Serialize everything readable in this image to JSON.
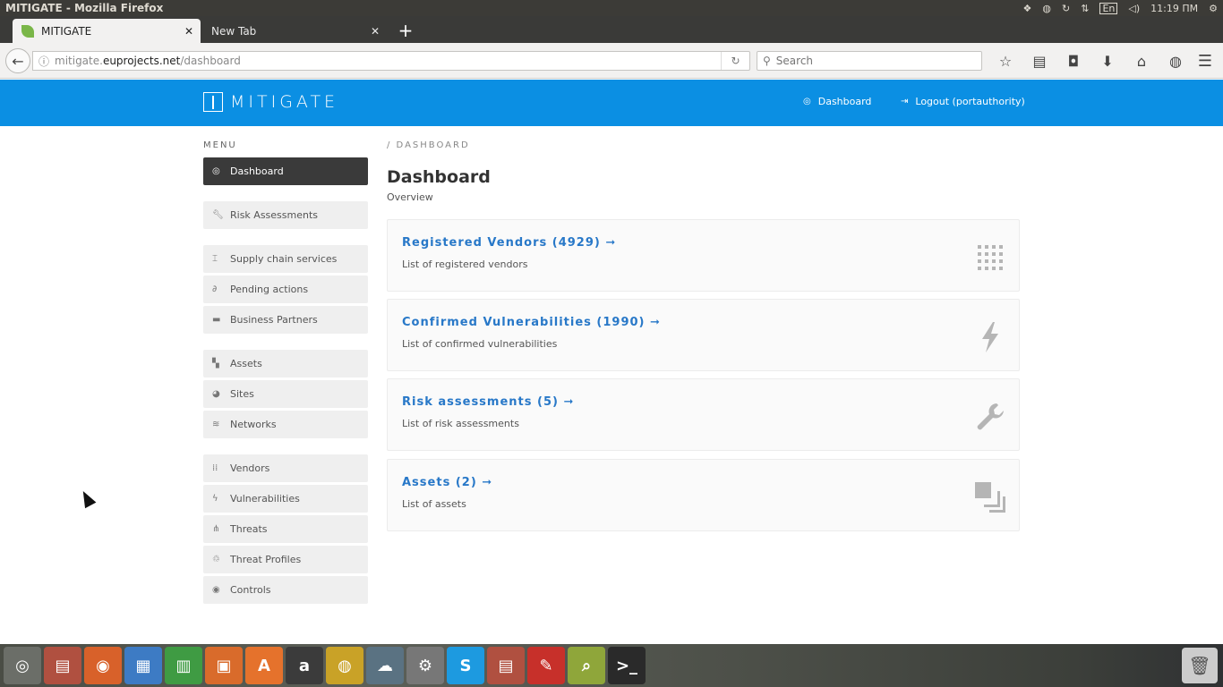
{
  "os": {
    "window_title": "MITIGATE - Mozilla Firefox",
    "clock": "11:19 ПМ",
    "keyboard_layout": "En"
  },
  "browser": {
    "tabs": [
      {
        "label": "MITIGATE",
        "active": true
      },
      {
        "label": "New Tab",
        "active": false
      }
    ],
    "url_prefix": "mitigate.",
    "url_domain": "euprojects.net",
    "url_path": "/dashboard",
    "search_placeholder": "Search"
  },
  "app": {
    "brand": "MITIGATE",
    "header_links": [
      {
        "label": "Dashboard",
        "icon": "dashboard-icon"
      },
      {
        "label": "Logout (portauthority)",
        "icon": "logout-icon"
      }
    ],
    "menu_label": "MENU",
    "sidebar": [
      {
        "label": "Dashboard",
        "icon": "dashboard-icon",
        "active": true
      },
      {
        "label": "Risk Assessments",
        "icon": "wrench-icon"
      },
      {
        "label": "Supply chain services",
        "icon": "supply-chain-icon"
      },
      {
        "label": "Pending actions",
        "icon": "paperclip-icon"
      },
      {
        "label": "Business Partners",
        "icon": "briefcase-icon"
      },
      {
        "label": "Assets",
        "icon": "assets-icon"
      },
      {
        "label": "Sites",
        "icon": "globe-icon"
      },
      {
        "label": "Networks",
        "icon": "wifi-icon"
      },
      {
        "label": "Vendors",
        "icon": "grid-icon"
      },
      {
        "label": "Vulnerabilities",
        "icon": "bolt-icon"
      },
      {
        "label": "Threats",
        "icon": "bug-icon"
      },
      {
        "label": "Threat Profiles",
        "icon": "recycle-icon"
      },
      {
        "label": "Controls",
        "icon": "eye-icon"
      }
    ],
    "breadcrumb": "/ DASHBOARD",
    "page_title": "Dashboard",
    "page_subtitle": "Overview",
    "cards": [
      {
        "title": "Registered Vendors (4929) ➞",
        "desc": "List of registered vendors",
        "icon": "grid-icon"
      },
      {
        "title": "Confirmed Vulnerabilities (1990) ➞",
        "desc": "List of confirmed vulnerabilities",
        "icon": "bolt-icon"
      },
      {
        "title": "Risk assessments (5) ➞",
        "desc": "List of risk assessments",
        "icon": "wrench-icon"
      },
      {
        "title": "Assets (2) ➞",
        "desc": "List of assets",
        "icon": "assets-icon"
      }
    ]
  },
  "taskbar": {
    "apps": [
      {
        "name": "ubuntu-dash-icon",
        "color": "#6b6e68",
        "glyph": "◎"
      },
      {
        "name": "files-icon",
        "color": "#b05040",
        "glyph": "▤"
      },
      {
        "name": "firefox-icon",
        "color": "#d8612a",
        "glyph": "◉"
      },
      {
        "name": "writer-icon",
        "color": "#3d7bc4",
        "glyph": "▦"
      },
      {
        "name": "calc-icon",
        "color": "#3f9b43",
        "glyph": "▥"
      },
      {
        "name": "impress-icon",
        "color": "#d96b2b",
        "glyph": "▣"
      },
      {
        "name": "software-center-icon",
        "color": "#e5722c",
        "glyph": "A"
      },
      {
        "name": "amazon-icon",
        "color": "#3b3b3b",
        "glyph": "a"
      },
      {
        "name": "chrome-icon",
        "color": "#c9a227",
        "glyph": "◍"
      },
      {
        "name": "cloud-icon",
        "color": "#5a7282",
        "glyph": "☁"
      },
      {
        "name": "settings-icon",
        "color": "#777",
        "glyph": "⚙"
      },
      {
        "name": "skype-icon",
        "color": "#1d9ae0",
        "glyph": "S"
      },
      {
        "name": "archive-icon",
        "color": "#b05040",
        "glyph": "▤"
      },
      {
        "name": "pdf-icon",
        "color": "#c7302a",
        "glyph": "✎"
      },
      {
        "name": "image-viewer-icon",
        "color": "#8fa63a",
        "glyph": "⌕"
      },
      {
        "name": "terminal-icon",
        "color": "#2a2a2a",
        "glyph": ">_"
      }
    ]
  }
}
